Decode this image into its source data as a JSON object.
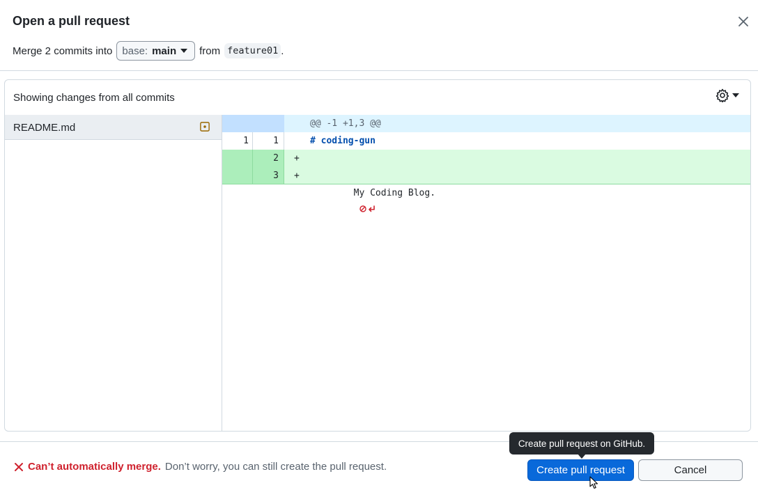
{
  "dialog": {
    "title": "Open a pull request",
    "close_icon": "close-icon"
  },
  "merge_info": {
    "prefix": "Merge 2 commits into",
    "base_label": "base:",
    "base_value": "main",
    "from_text": "from",
    "compare_branch": "feature01",
    "suffix": "."
  },
  "diff": {
    "toolbar_text": "Showing changes from all commits",
    "settings_icon": "gear-icon",
    "files": [
      {
        "name": "README.md",
        "status_icon": "file-modified-icon",
        "status_color": "#9a6700"
      }
    ],
    "hunk_header": "@@ -1 +1,3 @@",
    "lines": [
      {
        "type": "context",
        "old": "1",
        "new": "1",
        "sign": "",
        "code": "# coding-gun"
      },
      {
        "type": "add",
        "old": "",
        "new": "2",
        "sign": "+",
        "code": ""
      },
      {
        "type": "add",
        "old": "",
        "new": "3",
        "sign": "+",
        "code": "My Coding Blog."
      }
    ],
    "eol_marker_icon": "no-newline-icon"
  },
  "footer": {
    "status_icon": "x-icon",
    "status_error": "Can’t automatically merge.",
    "status_info": "Don’t worry, you can still create the pull request.",
    "create_label": "Create pull request",
    "cancel_label": "Cancel",
    "tooltip": "Create pull request on GitHub."
  },
  "colors": {
    "primary": "#0969da",
    "danger": "#cf222e",
    "addition_bg": "#dafbe1",
    "hunk_bg": "#ddf4ff"
  }
}
